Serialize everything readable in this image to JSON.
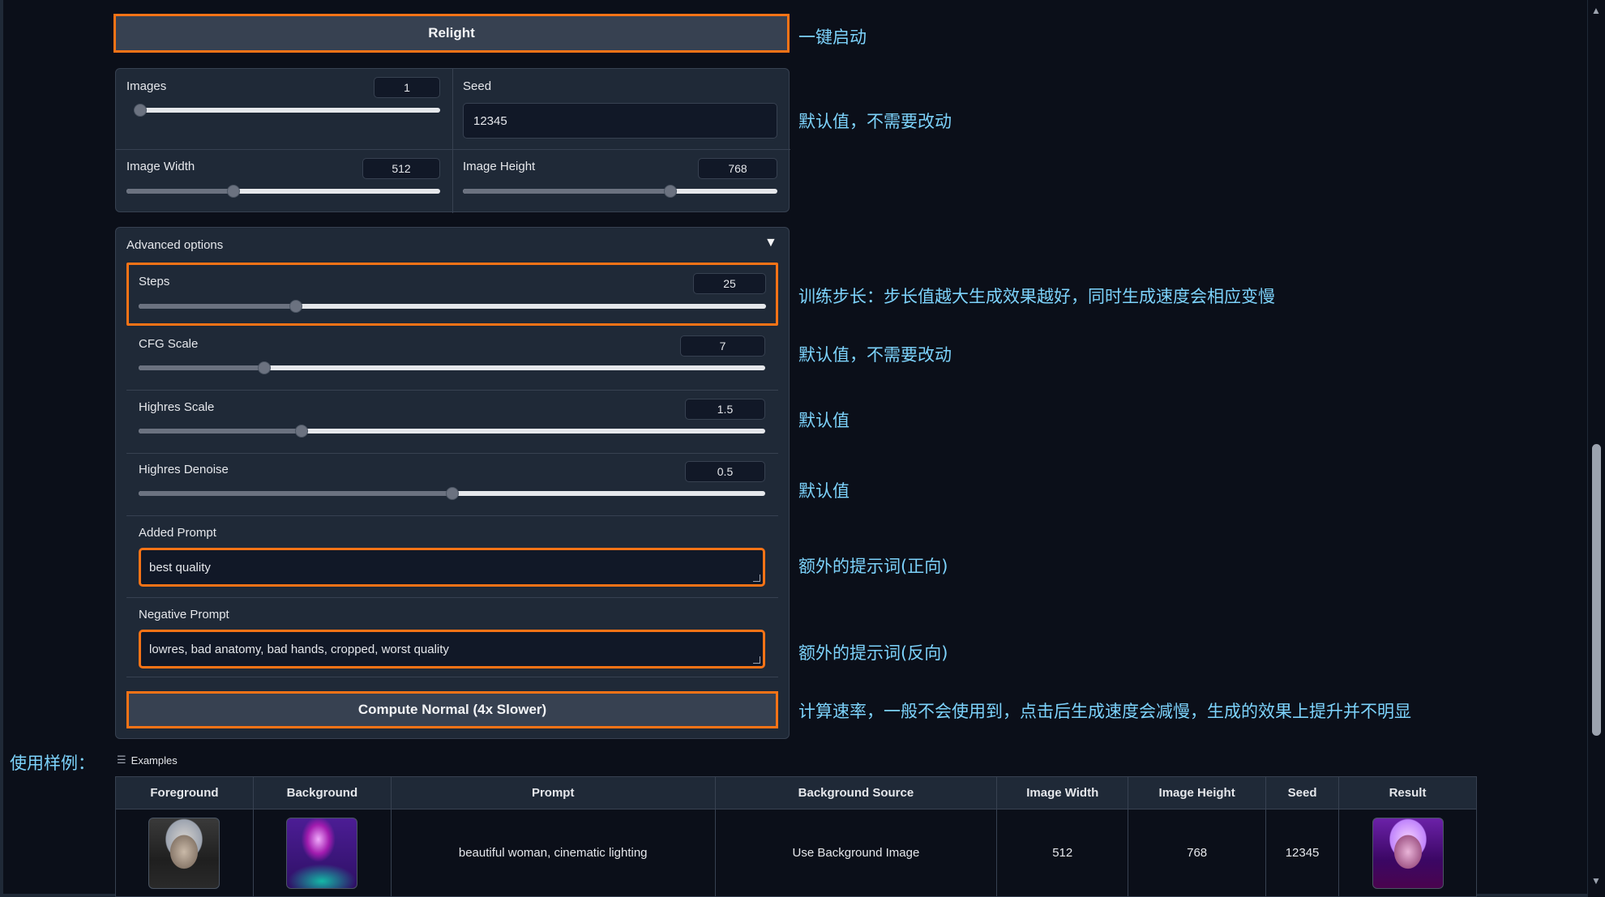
{
  "relight_button": "Relight",
  "images": {
    "label": "Images",
    "value": "1",
    "fraction": 0.0
  },
  "seed": {
    "label": "Seed",
    "value": "12345"
  },
  "image_width": {
    "label": "Image Width",
    "value": "512",
    "fraction": 0.34
  },
  "image_height": {
    "label": "Image Height",
    "value": "768",
    "fraction": 0.66
  },
  "advanced": {
    "title": "Advanced options",
    "toggle_icon": "▼",
    "steps": {
      "label": "Steps",
      "value": "25",
      "fraction": 0.25
    },
    "cfg": {
      "label": "CFG Scale",
      "value": "7",
      "fraction": 0.2
    },
    "highres_scale": {
      "label": "Highres Scale",
      "value": "1.5",
      "fraction": 0.26
    },
    "highres_denoise": {
      "label": "Highres Denoise",
      "value": "0.5",
      "fraction": 0.5
    },
    "added_prompt": {
      "label": "Added Prompt",
      "value": "best quality"
    },
    "negative_prompt": {
      "label": "Negative Prompt",
      "value": "lowres, bad anatomy, bad hands, cropped, worst quality"
    },
    "compute_normal_button": "Compute Normal (4x Slower)"
  },
  "notes": {
    "relight": "一键启动",
    "defaults1": "默认值，不需要改动",
    "steps": "训练步长：步长值越大生成效果越好，同时生成速度会相应变慢",
    "cfg": "默认值，不需要改动",
    "highres_scale": "默认值",
    "highres_denoise": "默认值",
    "added_prompt": "额外的提示词(正向)",
    "negative_prompt": "额外的提示词(反向)",
    "compute_normal": "计算速率，一般不会使用到，点击后生成速度会减慢，生成的效果上提升并不明显",
    "examples": "使用样例："
  },
  "examples": {
    "title": "Examples",
    "icon": "list-icon",
    "headers": [
      "Foreground",
      "Background",
      "Prompt",
      "Background Source",
      "Image Width",
      "Image Height",
      "Seed",
      "Result"
    ],
    "rows": [
      {
        "prompt": "beautiful woman, cinematic lighting",
        "bg_source": "Use Background Image",
        "width": "512",
        "height": "768",
        "seed": "12345"
      }
    ]
  },
  "colors": {
    "accent": "#f97316",
    "note": "#7dd3fc",
    "panel": "#1f2937",
    "page": "#0b0f19"
  }
}
